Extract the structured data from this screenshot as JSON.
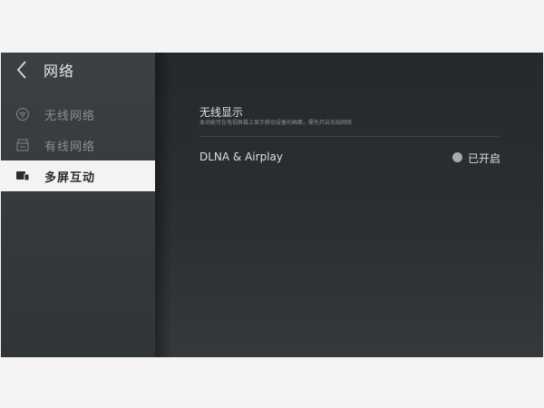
{
  "header": {
    "title": "网络",
    "back_icon": "chevron-left-icon"
  },
  "sidebar": {
    "items": [
      {
        "label": "无线网络",
        "icon": "wifi-icon",
        "active": false
      },
      {
        "label": "有线网络",
        "icon": "ethernet-icon",
        "active": false
      },
      {
        "label": "多屏互动",
        "icon": "multi-screen-icon",
        "active": true
      }
    ]
  },
  "main": {
    "section_title": "无线显示",
    "section_description": "本功能可在电视屏幕上显示移动设备的画面，需先开启无线网络",
    "setting": {
      "label": "DLNA & Airplay",
      "status": "已开启"
    }
  },
  "colors": {
    "sidebar_bg": "#373c3e",
    "main_bg": "#2a2e30",
    "active_item_bg": "#f3f3f3",
    "status_dot": "#a8abac"
  }
}
